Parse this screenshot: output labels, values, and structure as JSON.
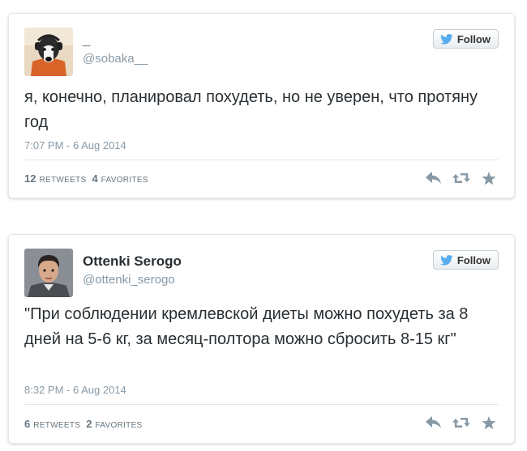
{
  "tweets": [
    {
      "name": "_",
      "handle": "@sobaka__",
      "follow_label": "Follow",
      "text": "я, конечно, планировал похудеть, но не уверен, что протяну год",
      "timestamp": "7:07 PM - 6 Aug 2014",
      "retweets": {
        "count": "12",
        "label": "RETWEETS"
      },
      "favorites": {
        "count": "4",
        "label": "FAVORITES"
      }
    },
    {
      "name": "Ottenki Serogo",
      "handle": "@ottenki_serogo",
      "follow_label": "Follow",
      "text": "\"При соблюдении кремлевской диеты можно похудеть за 8 дней на 5-6 кг, за месяц-полтора можно сбросить 8-15 кг\"",
      "timestamp": "8:32 PM - 6 Aug 2014",
      "retweets": {
        "count": "6",
        "label": "RETWEETS"
      },
      "favorites": {
        "count": "2",
        "label": "FAVORITES"
      }
    }
  ],
  "colors": {
    "twitter_blue": "#55acee",
    "text": "#292f33",
    "muted": "#8899a6",
    "icon": "#8899a6"
  },
  "icons": [
    "bird-icon",
    "reply-icon",
    "retweet-icon",
    "favorite-star-icon"
  ]
}
